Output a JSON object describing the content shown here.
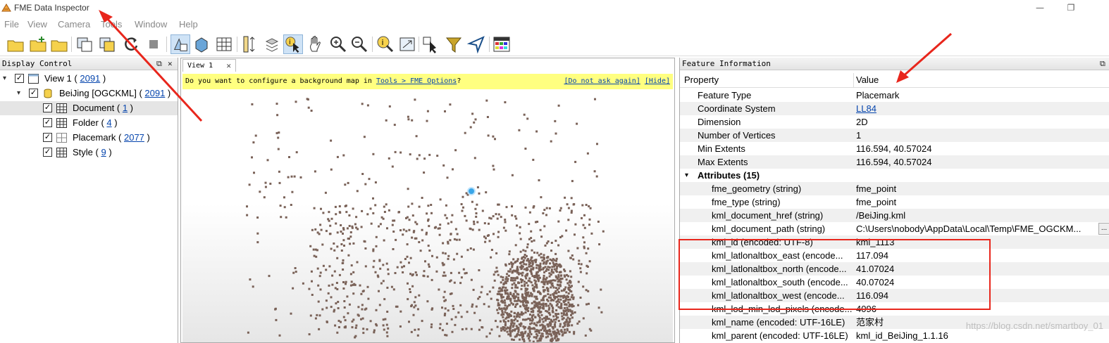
{
  "window": {
    "title": "FME Data Inspector",
    "minimize": "—",
    "restore": "❐"
  },
  "menu": [
    "File",
    "View",
    "Camera",
    "Tools",
    "Window",
    "Help"
  ],
  "display_control": {
    "header": "Display Control",
    "items": [
      {
        "label": "View 1",
        "count": "2091"
      },
      {
        "label": "BeiJing [OGCKML]",
        "count": "2091"
      },
      {
        "label": "Document",
        "count": "1"
      },
      {
        "label": "Folder",
        "count": "4"
      },
      {
        "label": "Placemark",
        "count": "2077"
      },
      {
        "label": "Style",
        "count": "9"
      }
    ]
  },
  "view": {
    "tab_label": "View 1",
    "notice_text": "Do you want to configure a background map in",
    "notice_link": "Tools > FME Options",
    "notice_q": "?",
    "do_not_ask": "[Do not ask again]",
    "hide": "[Hide]"
  },
  "feature_info": {
    "header": "Feature Information",
    "col_property": "Property",
    "col_value": "Value",
    "rows": [
      {
        "prop": "Feature Type",
        "value": "Placemark"
      },
      {
        "prop": "Coordinate System",
        "value": "LL84"
      },
      {
        "prop": "Dimension",
        "value": "2D"
      },
      {
        "prop": "Number of Vertices",
        "value": "1"
      },
      {
        "prop": "Min Extents",
        "value": "116.594, 40.57024"
      },
      {
        "prop": "Max Extents",
        "value": "116.594, 40.57024"
      }
    ],
    "attributes_label": "Attributes (15)",
    "attributes": [
      {
        "prop": "fme_geometry (string)",
        "value": "fme_point"
      },
      {
        "prop": "fme_type (string)",
        "value": "fme_point"
      },
      {
        "prop": "kml_document_href (string)",
        "value": "/BeiJing.kml"
      },
      {
        "prop": "kml_document_path (string)",
        "value": "C:\\Users\\nobody\\AppData\\Local\\Temp\\FME_OGCKM..."
      },
      {
        "prop": "kml_id (encoded: UTF-8)",
        "value": "kml_1113"
      },
      {
        "prop": "kml_latlonaltbox_east (encode...",
        "value": "117.094"
      },
      {
        "prop": "kml_latlonaltbox_north (encode...",
        "value": "41.07024"
      },
      {
        "prop": "kml_latlonaltbox_south (encode...",
        "value": "40.07024"
      },
      {
        "prop": "kml_latlonaltbox_west (encode...",
        "value": "116.094"
      },
      {
        "prop": "kml_lod_min_lod_pixels (encode...",
        "value": "4096"
      },
      {
        "prop": "kml_name (encoded: UTF-16LE)",
        "value": "范家村"
      },
      {
        "prop": "kml_parent (encoded: UTF-16LE)",
        "value": "kml_id_BeiJing_1.1.16"
      }
    ],
    "ellipsis": "..."
  },
  "watermark": "https://blog.csdn.net/smartboy_01",
  "colors": {
    "point": "#7a6258",
    "selected_point": "#3aa6e8",
    "annotation": "#e8261c",
    "notice_bg": "#ffff80"
  }
}
